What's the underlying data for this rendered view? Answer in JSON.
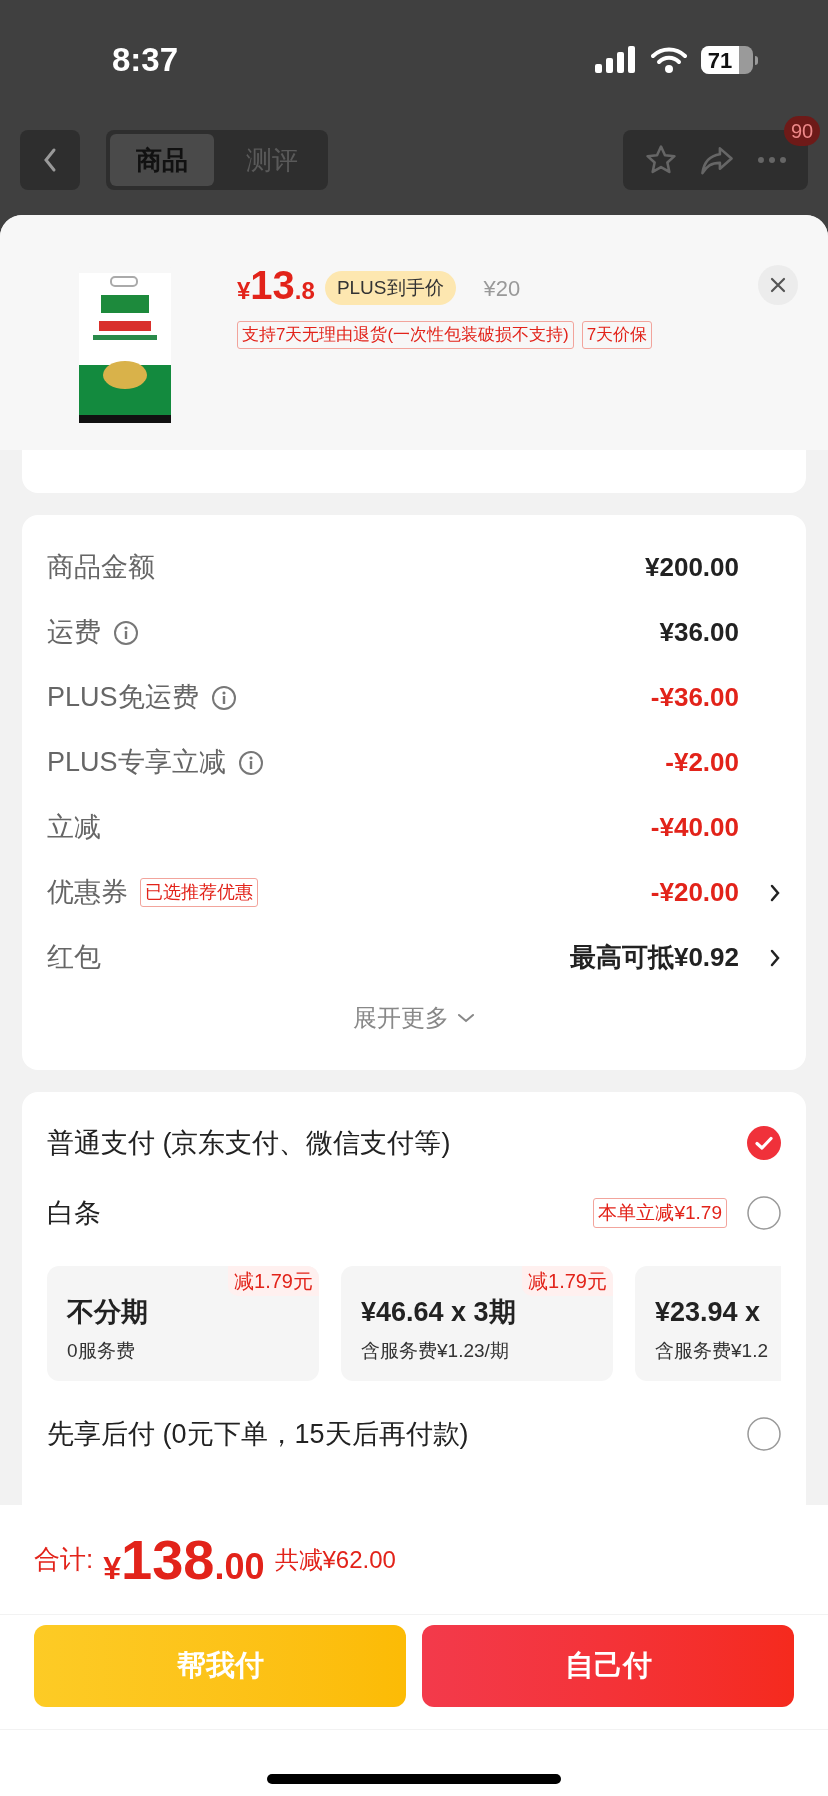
{
  "status_bar": {
    "time": "8:37",
    "battery": "71"
  },
  "nav": {
    "tabs": [
      {
        "label": "商品",
        "selected": true
      },
      {
        "label": "测评",
        "selected": false
      }
    ],
    "badge": "90"
  },
  "product": {
    "price_symbol": "¥",
    "price_int": "13",
    "price_dec": ".8",
    "plus_label": "PLUS到手价",
    "original_price": "¥20",
    "tags": [
      "支持7天无理由退货(一次性包装破损不支持)",
      "7天价保"
    ]
  },
  "summary": {
    "rows": [
      {
        "label": "商品金额",
        "info": false,
        "value": "¥200.00",
        "discount": false,
        "arrow": false
      },
      {
        "label": "运费",
        "info": true,
        "value": "¥36.00",
        "discount": false,
        "arrow": false
      },
      {
        "label": "PLUS免运费",
        "info": true,
        "value": "-¥36.00",
        "discount": true,
        "arrow": false
      },
      {
        "label": "PLUS专享立减",
        "info": true,
        "value": "-¥2.00",
        "discount": true,
        "arrow": false
      },
      {
        "label": "立减",
        "info": false,
        "value": "-¥40.00",
        "discount": true,
        "arrow": false
      },
      {
        "label": "优惠券",
        "info": false,
        "tag": "已选推荐优惠",
        "value": "-¥20.00",
        "discount": true,
        "arrow": true
      },
      {
        "label": "红包",
        "info": false,
        "value": "最高可抵¥0.92",
        "discount": false,
        "arrow": true
      }
    ],
    "expand": "展开更多"
  },
  "payment": {
    "methods": [
      {
        "label": "普通支付 (京东支付、微信支付等)",
        "selected": true
      },
      {
        "label": "白条",
        "selected": false,
        "tag": "本单立减¥1.79",
        "installments": [
          {
            "title": "不分期",
            "sub": "0服务费",
            "badge": "减1.79元"
          },
          {
            "title": "¥46.64 x 3期",
            "sub": "含服务费¥1.23/期",
            "badge": "减1.79元"
          },
          {
            "title": "¥23.94 x",
            "sub": "含服务费¥1.2"
          }
        ]
      },
      {
        "label": "先享后付 (0元下单，15天后再付款)",
        "selected": false
      }
    ]
  },
  "footer": {
    "total_label": "合计:",
    "total_symbol": "¥",
    "total_int": "138",
    "total_dec": ".00",
    "saved": "共减¥62.00",
    "buttons": [
      {
        "label": "帮我付",
        "kind": "secondary"
      },
      {
        "label": "自己付",
        "kind": "primary"
      }
    ]
  }
}
